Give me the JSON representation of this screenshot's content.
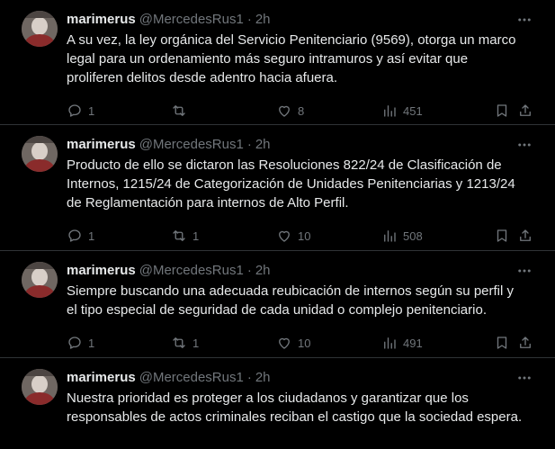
{
  "colors": {
    "background": "#000000",
    "text": "#e7e9ea",
    "secondary": "#71767b",
    "divider": "#2f3336"
  },
  "icons": {
    "more": "more-horizontal-icon",
    "reply": "reply-icon",
    "retweet": "retweet-icon",
    "like": "heart-icon",
    "views": "views-icon",
    "bookmark": "bookmark-icon",
    "share": "share-icon"
  },
  "tweets": [
    {
      "name": "marimerus",
      "handle": "@MercedesRus1",
      "separator": "·",
      "time": "2h",
      "text": "A su vez, la ley orgánica del Servicio Penitenciario (9569), otorga un marco legal para un ordenamiento más seguro intramuros y así evitar que proliferen delitos desde adentro hacia afuera.",
      "replies": "1",
      "retweets": "",
      "likes": "8",
      "views": "451"
    },
    {
      "name": "marimerus",
      "handle": "@MercedesRus1",
      "separator": "·",
      "time": "2h",
      "text": "Producto de ello se dictaron las Resoluciones 822/24 de Clasificación de Internos, 1215/24 de Categorización de Unidades Penitenciarias y 1213/24 de Reglamentación para internos de Alto Perfil.",
      "replies": "1",
      "retweets": "1",
      "likes": "10",
      "views": "508"
    },
    {
      "name": "marimerus",
      "handle": "@MercedesRus1",
      "separator": "·",
      "time": "2h",
      "text": "Siempre buscando una adecuada reubicación de internos según su perfil y el tipo especial de seguridad de cada unidad o complejo penitenciario.",
      "replies": "1",
      "retweets": "1",
      "likes": "10",
      "views": "491"
    },
    {
      "name": "marimerus",
      "handle": "@MercedesRus1",
      "separator": "·",
      "time": "2h",
      "text": "Nuestra prioridad es proteger a los ciudadanos y garantizar que los responsables de actos criminales reciban el castigo que la sociedad espera."
    }
  ]
}
